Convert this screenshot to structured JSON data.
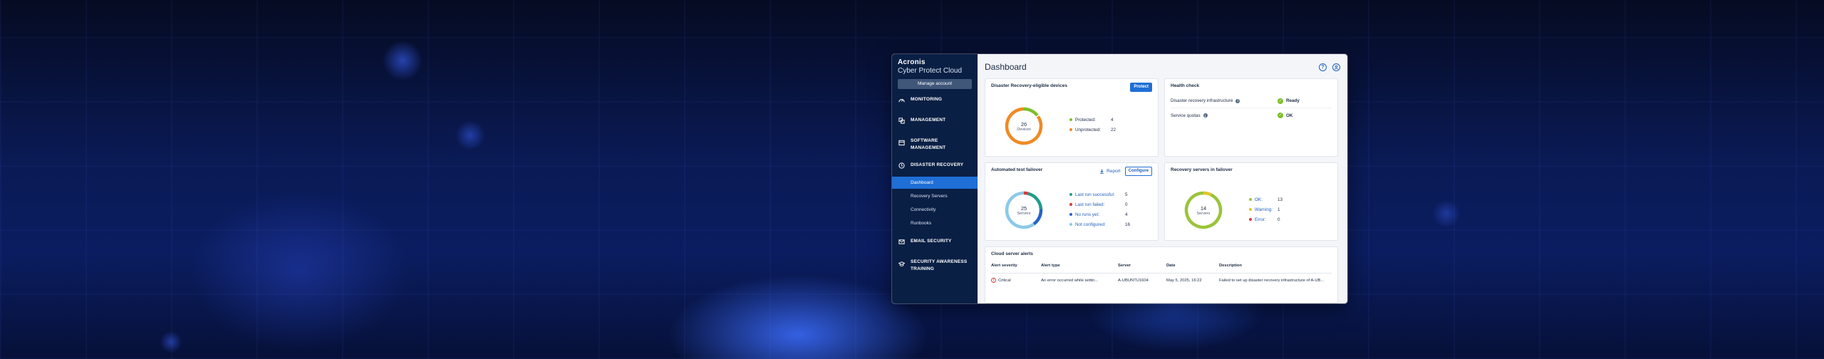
{
  "sidebar": {
    "brand_name": "Acronis",
    "brand_product": "Cyber Protect Cloud",
    "manage_account": "Manage account",
    "nav": [
      {
        "label": "MONITORING",
        "icon": "monitoring-icon"
      },
      {
        "label": "MANAGEMENT",
        "icon": "management-icon"
      },
      {
        "label": "SOFTWARE MANAGEMENT",
        "icon": "software-icon"
      },
      {
        "label": "DISASTER RECOVERY",
        "icon": "disaster-recovery-icon"
      },
      {
        "label": "EMAIL SECURITY",
        "icon": "email-icon"
      },
      {
        "label": "SECURITY AWARENESS TRAINING",
        "icon": "graduation-cap-icon"
      }
    ],
    "dr_sub": [
      "Dashboard",
      "Recovery Servers",
      "Connectivity",
      "Runbooks"
    ],
    "active_sub": "Dashboard"
  },
  "header": {
    "title": "Dashboard"
  },
  "dr_devices": {
    "title": "Disaster Recovery-eligible devices",
    "button": "Protect",
    "total": "26",
    "unit": "Devices",
    "legend": [
      {
        "label": "Protected:",
        "value": 4,
        "color": "#7bbf2a"
      },
      {
        "label": "Unprotected:",
        "value": 22,
        "color": "#f08a24"
      }
    ]
  },
  "health": {
    "title": "Health check",
    "rows": [
      {
        "label": "Disaster recovery infrastructure",
        "status": "Ready"
      },
      {
        "label": "Service quotas",
        "status": "OK"
      }
    ]
  },
  "failover_test": {
    "title": "Automated test failover",
    "report": "Report",
    "configure": "Configure",
    "total": "25",
    "unit": "Servers",
    "legend": [
      {
        "label": "Last run successful:",
        "value": 5,
        "color": "#1f9d8a"
      },
      {
        "label": "Last run failed:",
        "value": 0,
        "color": "#d83a3a"
      },
      {
        "label": "No runs yet:",
        "value": 4,
        "color": "#2563c9"
      },
      {
        "label": "Not configured:",
        "value": 16,
        "color": "#8cc9e8"
      }
    ]
  },
  "recovery_servers": {
    "title": "Recovery servers in failover",
    "total": "14",
    "unit": "Servers",
    "legend": [
      {
        "label": "OK:",
        "value": 13,
        "color": "#9ac43a"
      },
      {
        "label": "Warning:",
        "value": 1,
        "color": "#e6c42a"
      },
      {
        "label": "Error:",
        "value": 0,
        "color": "#d83a3a"
      }
    ]
  },
  "alerts": {
    "title": "Cloud server alerts",
    "columns": [
      "Alert severity",
      "Alert type",
      "Server",
      "Date",
      "Description"
    ],
    "rows": [
      {
        "severity": "Critical",
        "type": "An error occurred while settin...",
        "server": "A-UBUNTU1604",
        "date": "May 5, 2025, 16:22",
        "description": "Failed to set up disaster recovery infrastructure of A-UB..."
      }
    ]
  }
}
